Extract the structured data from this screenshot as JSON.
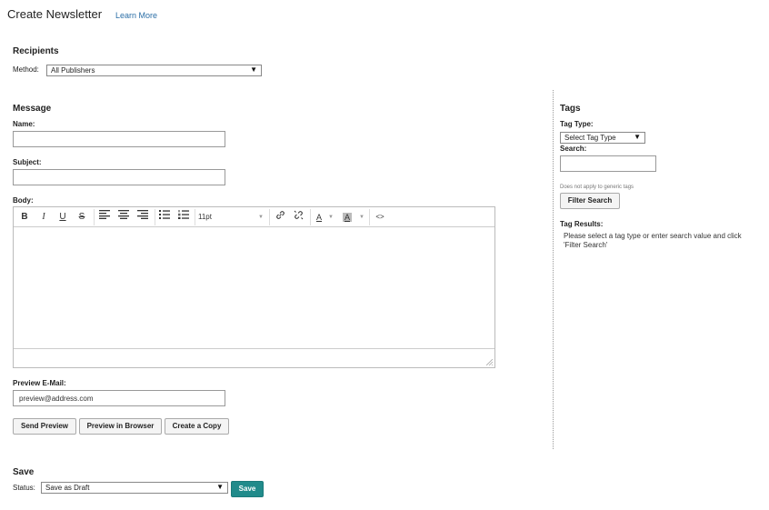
{
  "header": {
    "title": "Create Newsletter",
    "learn_more": "Learn More"
  },
  "recipients": {
    "heading": "Recipients",
    "method_label": "Method:",
    "method_value": "All Publishers"
  },
  "message": {
    "heading": "Message",
    "name_label": "Name:",
    "name_value": "",
    "subject_label": "Subject:",
    "subject_value": "",
    "body_label": "Body:",
    "font_size": "11pt",
    "preview_label": "Preview E-Mail:",
    "preview_value": "preview@address.com",
    "buttons": {
      "send_preview": "Send Preview",
      "preview_browser": "Preview in Browser",
      "create_copy": "Create a Copy"
    }
  },
  "toolbar": {
    "bold": "B",
    "italic": "I",
    "underline": "U",
    "strike": "S",
    "text_color": "A",
    "bg_color": "A",
    "code": "<>"
  },
  "save": {
    "heading": "Save",
    "status_label": "Status:",
    "status_value": "Save as Draft",
    "save_label": "Save"
  },
  "tags": {
    "heading": "Tags",
    "type_label": "Tag Type:",
    "type_value": "Select Tag Type",
    "search_label": "Search:",
    "search_value": "",
    "note": "Does not apply to generic tags",
    "filter_button": "Filter Search",
    "results_label": "Tag Results:",
    "results_text": "Please select a tag type or enter search value and click 'Filter Search'"
  },
  "colors": {
    "link": "#2a6ea6",
    "primary": "#218b8b",
    "border": "#999999"
  },
  "icons": [
    "bold-icon",
    "italic-icon",
    "underline-icon",
    "strikethrough-icon",
    "align-left-icon",
    "align-center-icon",
    "align-right-icon",
    "bullet-list-icon",
    "numbered-list-icon",
    "link-icon",
    "unlink-icon",
    "text-color-icon",
    "background-color-icon",
    "source-code-icon",
    "resize-handle-icon"
  ]
}
